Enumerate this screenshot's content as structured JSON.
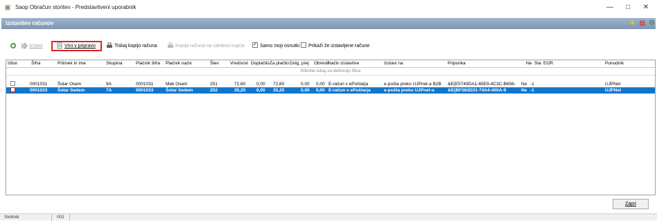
{
  "window": {
    "title": "Saop Obračun storitev - Predstavitveni uporabnik"
  },
  "header": {
    "title": "Izstavitev računov"
  },
  "toolbar": {
    "izstavi": "Izstavi",
    "vrni": "Vrni v pripravo",
    "tiskaj": "Tiskaj kopijo računa",
    "kopija_kupca": "Kopija računa na zahtevo kupca",
    "samo_moji": "Samo moji osnutki",
    "prikazi": "Prikaži že izstavljene račune"
  },
  "grid": {
    "columns": [
      "Izbor",
      "Šifra",
      "Priimek in ime",
      "Skupina",
      "Plačnik šifra",
      "Plačnik naziv",
      "Štev",
      "Vrednost",
      "Doplačilo",
      "Za plačilo",
      "Dolg, prej",
      "Obresti",
      "Način izstavitve",
      "Izstavi na",
      "Priponka",
      "Ne",
      "Sta",
      "EOR",
      "Ponudnik"
    ],
    "filter_hint": "Kliknite tukaj za definicijo filtra",
    "rows": [
      {
        "sifra": "0001031",
        "ime": "Šolar Osem",
        "skupina": "9A",
        "placnik_sifra": "0001031",
        "placnik_naziv": "Mati Osem",
        "stev": "251",
        "vrednost": "72,60",
        "doplacilo": "0,00",
        "za_placilo": "72,60",
        "dolg": "0,00",
        "obresti": "0,00",
        "nacin": "E-račun v ePoštarja",
        "izstavi_na": "e-pošta preko UJPnet-a B2B",
        "priponka": "&E{E5749DA1-65E9-4C3C-B656-",
        "ne": "Ne",
        "sta": "-1",
        "eor": "",
        "ponudnik": "UJPNet"
      },
      {
        "sifra": "0001033",
        "ime": "Šolar Sedem",
        "skupina": "7A",
        "placnik_sifra": "0001033",
        "placnik_naziv": "Šolar Sedem",
        "stev": "252",
        "vrednost": "35,20",
        "doplacilo": "0,00",
        "za_placilo": "35,20",
        "dolg": "0,00",
        "obresti": "0,00",
        "nacin": "E-račun v ePoštarja",
        "izstavi_na": "e-pošta preko UJPnet-a",
        "priponka": "&E{BF563D31-74A4-400A-9",
        "ne": "Ne",
        "sta": "-1",
        "eor": "",
        "ponudnik": "UJPNet"
      }
    ]
  },
  "buttons": {
    "zapri": "Zapri"
  },
  "status": {
    "user": "Skrbnik",
    "code": "001"
  }
}
